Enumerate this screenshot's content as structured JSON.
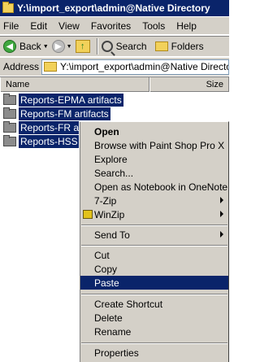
{
  "window": {
    "title": "Y:\\import_export\\admin@Native Directory"
  },
  "menubar": {
    "items": [
      "File",
      "Edit",
      "View",
      "Favorites",
      "Tools",
      "Help"
    ]
  },
  "toolbar": {
    "back_label": "Back",
    "search_label": "Search",
    "folders_label": "Folders"
  },
  "address": {
    "label": "Address",
    "value": "Y:\\import_export\\admin@Native Directory"
  },
  "columns": {
    "name": "Name",
    "size": "Size"
  },
  "files": [
    {
      "name": "Reports-EPMA artifacts"
    },
    {
      "name": "Reports-FM artifacts"
    },
    {
      "name": "Reports-FR artifacts"
    },
    {
      "name": "Reports-HSS artifacts"
    }
  ],
  "context_menu": {
    "open": "Open",
    "browse": "Browse with Paint Shop Pro X",
    "explore": "Explore",
    "search": "Search...",
    "onenote": "Open as Notebook in OneNote",
    "zip7": "7-Zip",
    "winzip": "WinZip",
    "send_to": "Send To",
    "cut": "Cut",
    "copy": "Copy",
    "paste": "Paste",
    "create_shortcut": "Create Shortcut",
    "delete": "Delete",
    "rename": "Rename",
    "properties": "Properties"
  },
  "colors": {
    "selection": "#0a246a",
    "chrome": "#d4d0c8"
  }
}
